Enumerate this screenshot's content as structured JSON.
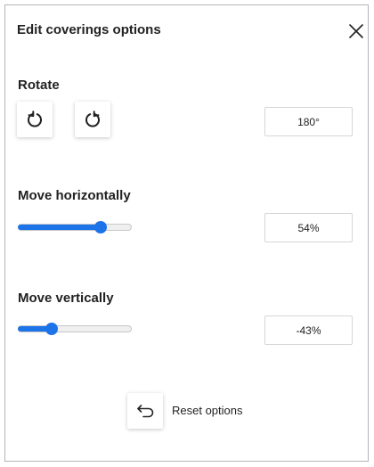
{
  "dialog": {
    "title": "Edit coverings options",
    "close_icon": "close-icon"
  },
  "rotate": {
    "label": "Rotate",
    "rotate_left_icon": "rotate-counterclockwise-icon",
    "rotate_right_icon": "rotate-clockwise-icon",
    "value": "180°"
  },
  "move_horizontally": {
    "label": "Move horizontally",
    "value": "54%",
    "slider_level": 0.73
  },
  "move_vertically": {
    "label": "Move vertically",
    "value": "-43%",
    "slider_level": 0.3
  },
  "reset": {
    "label": "Reset options",
    "icon": "undo-arrow-icon"
  },
  "colors": {
    "accent": "#1c74e8",
    "border": "#b5b5b5",
    "text": "#222222"
  }
}
